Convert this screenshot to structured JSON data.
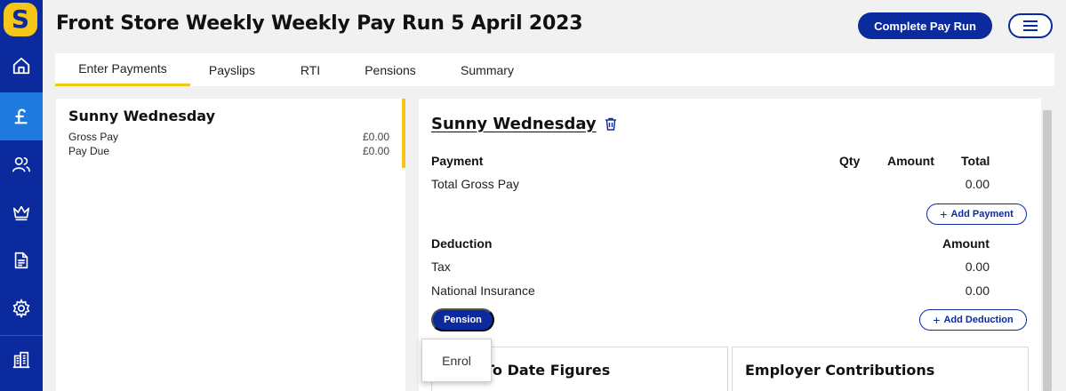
{
  "app": {
    "logo_letter": "S"
  },
  "sidebar": {
    "items": [
      {
        "name": "home",
        "icon": "home-icon",
        "active": false
      },
      {
        "name": "payroll",
        "icon": "pound-icon",
        "active": true
      },
      {
        "name": "employees",
        "icon": "users-icon",
        "active": false
      },
      {
        "name": "pensions",
        "icon": "crown-icon",
        "active": false
      },
      {
        "name": "reports",
        "icon": "document-icon",
        "active": false
      },
      {
        "name": "settings",
        "icon": "gear-icon",
        "active": false
      },
      {
        "name": "company",
        "icon": "building-icon",
        "active": false
      }
    ]
  },
  "header": {
    "title": "Front Store Weekly Weekly Pay Run 5 April 2023",
    "complete_button": "Complete Pay Run",
    "menu_icon": "hamburger-icon"
  },
  "tabs": [
    {
      "label": "Enter Payments",
      "active": true
    },
    {
      "label": "Payslips",
      "active": false
    },
    {
      "label": "RTI",
      "active": false
    },
    {
      "label": "Pensions",
      "active": false
    },
    {
      "label": "Summary",
      "active": false
    }
  ],
  "employee_list": [
    {
      "name": "Sunny Wednesday",
      "rows": [
        {
          "label": "Gross Pay",
          "value": "£0.00"
        },
        {
          "label": "Pay Due",
          "value": "£0.00"
        }
      ]
    }
  ],
  "detail": {
    "employee_name": "Sunny Wednesday",
    "payment": {
      "headers": {
        "payment": "Payment",
        "qty": "Qty",
        "amount": "Amount",
        "total": "Total"
      },
      "rows": [
        {
          "label": "Total Gross Pay",
          "total": "0.00"
        }
      ],
      "add_button": "Add Payment"
    },
    "deduction": {
      "headers": {
        "deduction": "Deduction",
        "amount": "Amount"
      },
      "rows": [
        {
          "label": "Tax",
          "amount": "0.00"
        },
        {
          "label": "National Insurance",
          "amount": "0.00"
        }
      ],
      "add_button": "Add Deduction",
      "pension_button": "Pension"
    },
    "boxes": {
      "ytd_title": "Year To Date Figures",
      "employer_title": "Employer Contributions"
    }
  },
  "dropdown": {
    "items": [
      "Enrol"
    ]
  },
  "colors": {
    "primary": "#0a2a9e",
    "accent": "#f5c518",
    "active_nav": "#1f7ae0"
  }
}
